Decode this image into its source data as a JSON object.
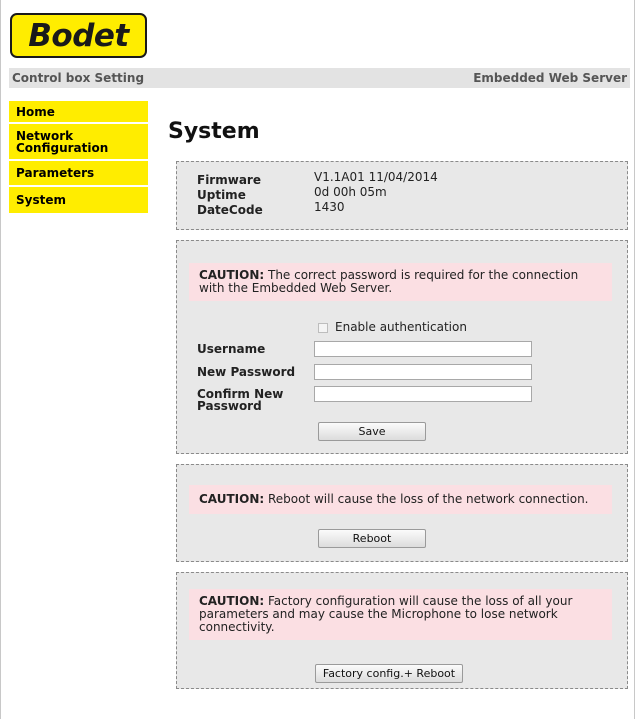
{
  "brand": {
    "logo_text": "Bodet",
    "logo_color": "#ffed00"
  },
  "header": {
    "left": "Control box Setting",
    "right": "Embedded Web Server"
  },
  "sidebar": {
    "items": [
      {
        "label": "Home"
      },
      {
        "label": "Network Configuration"
      },
      {
        "label": "Parameters"
      },
      {
        "label": "System"
      }
    ]
  },
  "main": {
    "title": "System",
    "info": {
      "rows": [
        {
          "label": "Firmware",
          "value": "V1.1A01 11/04/2014"
        },
        {
          "label": "Uptime",
          "value": "0d 00h 05m"
        },
        {
          "label": "DateCode",
          "value": "1430"
        }
      ]
    },
    "auth": {
      "caution_prefix": "CAUTION:",
      "caution_text": " The correct password is required for the connection with the Embedded Web Server.",
      "enable_label": "Enable authentication",
      "enable_checked": false,
      "username_label": "Username",
      "username_value": "",
      "new_password_label": "New Password",
      "new_password_value": "",
      "confirm_password_label": "Confirm New Password",
      "confirm_password_value": "",
      "save_label": "Save"
    },
    "reboot": {
      "caution_prefix": "CAUTION:",
      "caution_text": " Reboot will cause the loss of the network connection.",
      "button_label": "Reboot"
    },
    "factory": {
      "caution_prefix": "CAUTION:",
      "caution_text": " Factory configuration will cause the loss of all your parameters and may cause the Microphone to lose network connectivity.",
      "button_label": "Factory config.+ Reboot"
    }
  },
  "colors": {
    "accent_yellow": "#ffed00",
    "caution_background": "#fbdfe3",
    "panel_background": "#e8e8e8",
    "header_background": "#e3e3e3"
  }
}
